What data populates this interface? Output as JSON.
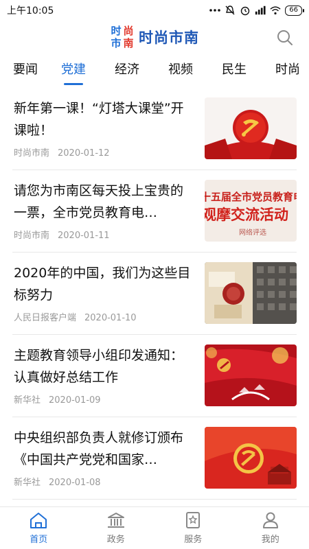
{
  "status": {
    "time": "上午10:05",
    "battery": "66"
  },
  "header": {
    "logo_chars": [
      "时",
      "尚",
      "市",
      "南"
    ],
    "title": "时尚市南"
  },
  "tabs": [
    {
      "label": "要闻"
    },
    {
      "label": "党建"
    },
    {
      "label": "经济"
    },
    {
      "label": "视频"
    },
    {
      "label": "民生"
    },
    {
      "label": "时尚"
    }
  ],
  "active_tab": "党建",
  "news": [
    {
      "title": "新年第一课！“灯塔大课堂”开课啦！",
      "source": "时尚市南",
      "date": "2020-01-12",
      "thumb": "party-emblem-podium"
    },
    {
      "title": "请您为市南区每天投上宝贵的一票，全市党员教育电…",
      "source": "时尚市南",
      "date": "2020-01-11",
      "thumb_text": [
        "十五届全市党员教育电",
        "观摩交流活动",
        "网络评选"
      ]
    },
    {
      "title": "2020年的中国，我们为这些目标努力",
      "source": "人民日报客户端",
      "date": "2020-01-10",
      "thumb": "flatlay-photo"
    },
    {
      "title": "主题教育领导小组印发通知：认真做好总结工作",
      "source": "新华社",
      "date": "2020-01-09",
      "thumb": "red-flag-celebration"
    },
    {
      "title": "中央组织部负责人就修订颁布《中国共产党党和国家…",
      "source": "新华社",
      "date": "2020-01-08",
      "thumb": "party-emblem-gate"
    }
  ],
  "bottom_nav": [
    {
      "label": "首页",
      "icon": "home-icon",
      "active": true
    },
    {
      "label": "政务",
      "icon": "government-building-icon",
      "active": false
    },
    {
      "label": "服务",
      "icon": "service-bookmark-icon",
      "active": false
    },
    {
      "label": "我的",
      "icon": "profile-icon",
      "active": false
    }
  ],
  "colors": {
    "accent": "#1f6fd6",
    "brand_red": "#e23a2e",
    "meta_gray": "#999999"
  }
}
